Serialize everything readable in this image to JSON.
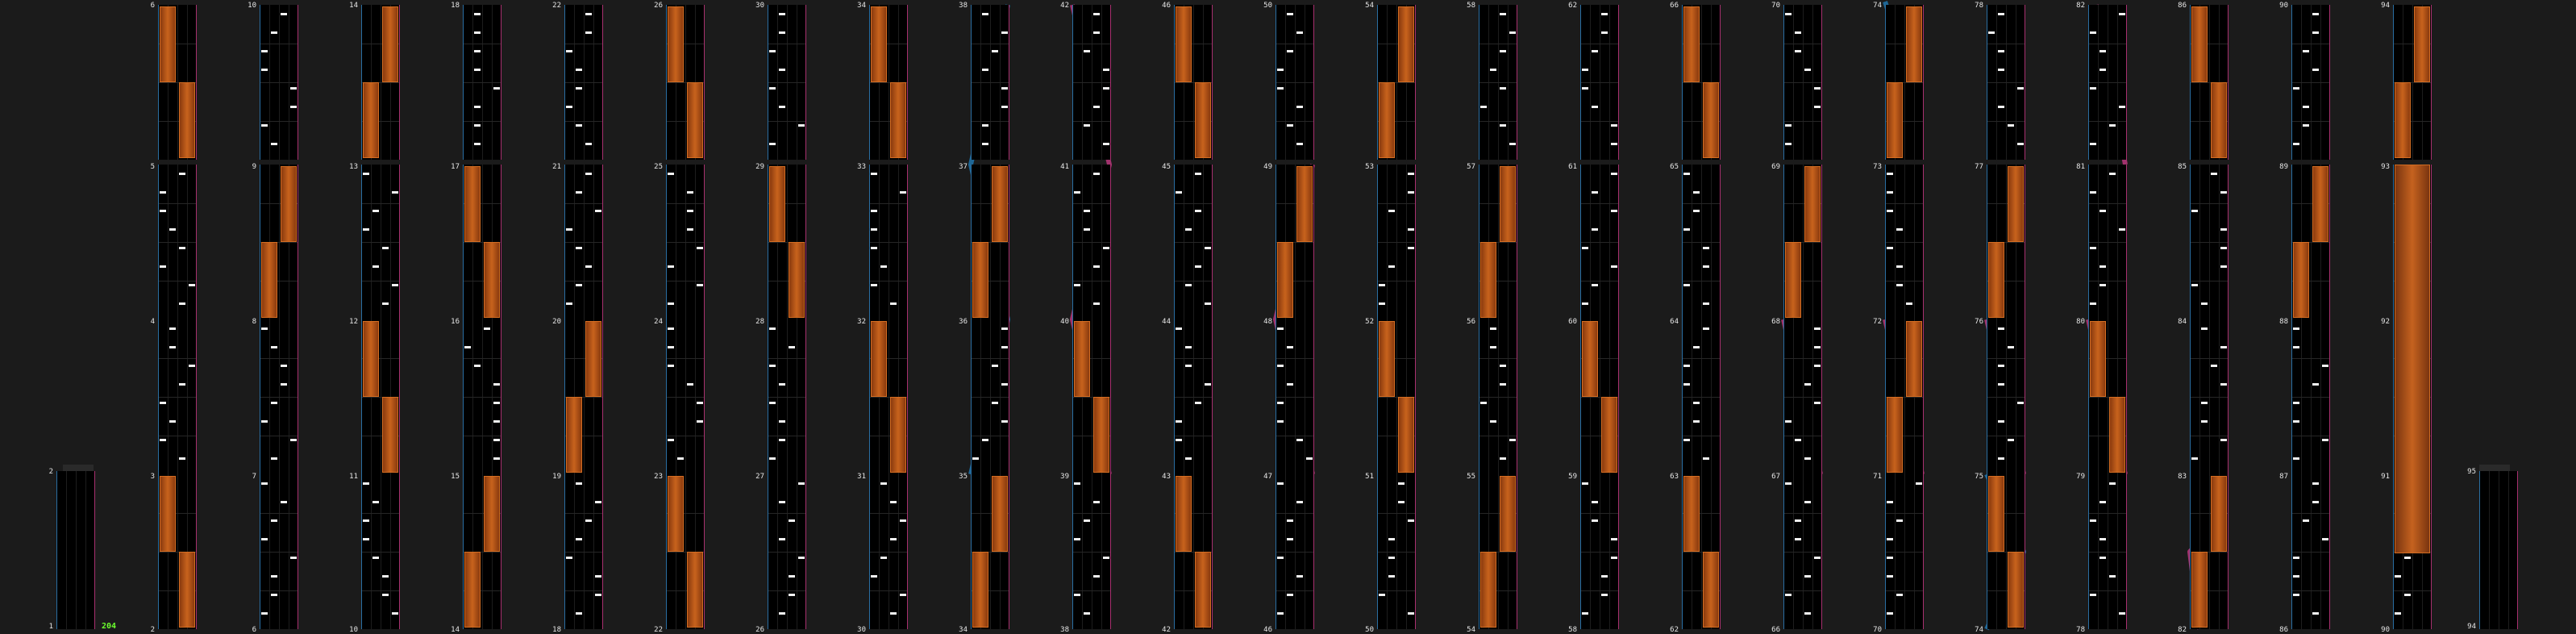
{
  "chart": {
    "bpm_label": "204",
    "start_label": "1",
    "end_label": "95",
    "columns": [
      {
        "labels": [
          "2",
          "3",
          "4",
          "5",
          "6"
        ]
      },
      {
        "labels": [
          "6",
          "7",
          "8",
          "9",
          "10"
        ]
      },
      {
        "labels": [
          "10",
          "11",
          "12",
          "13",
          "14"
        ]
      },
      {
        "labels": [
          "14",
          "15",
          "16",
          "17",
          "18"
        ]
      },
      {
        "labels": [
          "18",
          "19",
          "20",
          "21",
          "22"
        ]
      },
      {
        "labels": [
          "22",
          "23",
          "24",
          "25",
          "26"
        ]
      },
      {
        "labels": [
          "26",
          "27",
          "28",
          "29",
          "30"
        ]
      },
      {
        "labels": [
          "30",
          "31",
          "32",
          "33",
          "34"
        ]
      },
      {
        "labels": [
          "34",
          "35",
          "36",
          "37",
          "38"
        ]
      },
      {
        "labels": [
          "38",
          "39",
          "40",
          "41",
          "42"
        ]
      },
      {
        "labels": [
          "42",
          "43",
          "44",
          "45",
          "46"
        ]
      },
      {
        "labels": [
          "46",
          "47",
          "48",
          "49",
          "50"
        ]
      },
      {
        "labels": [
          "50",
          "51",
          "52",
          "53",
          "54"
        ]
      },
      {
        "labels": [
          "54",
          "55",
          "56",
          "57",
          "58"
        ]
      },
      {
        "labels": [
          "58",
          "59",
          "60",
          "61",
          "62"
        ]
      },
      {
        "labels": [
          "62",
          "63",
          "64",
          "65",
          "66"
        ]
      },
      {
        "labels": [
          "66",
          "67",
          "68",
          "69",
          "70"
        ]
      },
      {
        "labels": [
          "70",
          "71",
          "72",
          "73",
          "74"
        ]
      },
      {
        "labels": [
          "74",
          "75",
          "76",
          "77",
          "78"
        ]
      },
      {
        "labels": [
          "78",
          "79",
          "80",
          "81",
          "82"
        ]
      },
      {
        "labels": [
          "82",
          "83",
          "84",
          "85",
          "86"
        ]
      },
      {
        "labels": [
          "86",
          "87",
          "88",
          "89",
          "90"
        ]
      },
      {
        "labels": [
          "90",
          "91",
          "92",
          "93",
          "94"
        ]
      },
      {
        "labels": [
          "94"
        ]
      }
    ]
  }
}
